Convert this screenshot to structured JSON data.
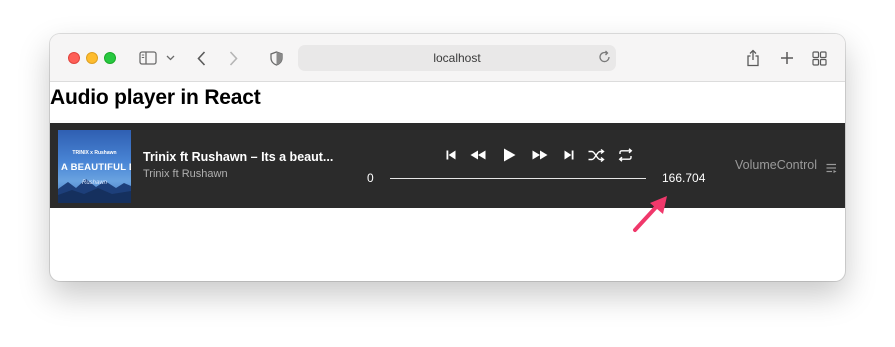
{
  "browser": {
    "url": "localhost",
    "icons": [
      "sidebar-icon",
      "chevron-down-icon",
      "back-icon",
      "forward-icon",
      "shield-icon",
      "reload-icon",
      "share-icon",
      "plus-icon",
      "tabs-grid-icon"
    ]
  },
  "page": {
    "heading": "Audio player in React"
  },
  "player": {
    "cover": {
      "top_text": "TRINIX x Rushawn",
      "main_text": "S A BEAUTIFUL D",
      "signature": "Rushawn"
    },
    "track_title": "Trinix ft Rushawn – Its a beaut...",
    "artist": "Trinix ft Rushawn",
    "current_time": "0",
    "duration": "166.704",
    "progress": 0,
    "volume_label": "VolumeControl",
    "controls": [
      "skip-start-icon",
      "rewind-icon",
      "play-icon",
      "fast-forward-icon",
      "skip-end-icon",
      "shuffle-icon",
      "repeat-icon"
    ]
  },
  "colors": {
    "player_bg": "#2b2b2b",
    "annotation_arrow": "#f0386b"
  }
}
